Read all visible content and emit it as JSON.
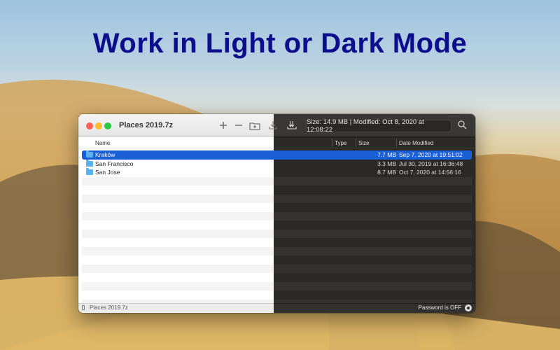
{
  "headline": "Work in Light or Dark Mode",
  "window": {
    "title": "Places 2019.7z",
    "info": "Size: 14.9 MB  |  Modified: Oct 8, 2020 at 12:08:22",
    "toolbar": {
      "add_icon": "plus-icon",
      "remove_icon": "minus-icon",
      "new_folder_icon": "new-folder-icon",
      "extract_icon": "extract-icon",
      "extract_all_icon": "extract-all-icon",
      "search_icon": "search-icon"
    }
  },
  "columns": [
    "Name",
    "Type",
    "Size",
    "Date Modified"
  ],
  "rows": [
    {
      "name": "Kraków",
      "size": "7.7 MB",
      "date": "Sep 7, 2020 at 19:51:02",
      "selected": true
    },
    {
      "name": "San Francisco",
      "size": "3.3 MB",
      "date": "Jul 30, 2019 at 16:36:48",
      "selected": false
    },
    {
      "name": "San Jose",
      "size": "8.7 MB",
      "date": "Oct 7, 2020 at 14:56:16",
      "selected": false
    }
  ],
  "status": {
    "archive_name": "Places 2019.7z",
    "password": "Password is OFF"
  },
  "colors": {
    "headline": "#0d0e8c",
    "selection": "#1b5fd6",
    "folder": "#5ab0ea"
  }
}
